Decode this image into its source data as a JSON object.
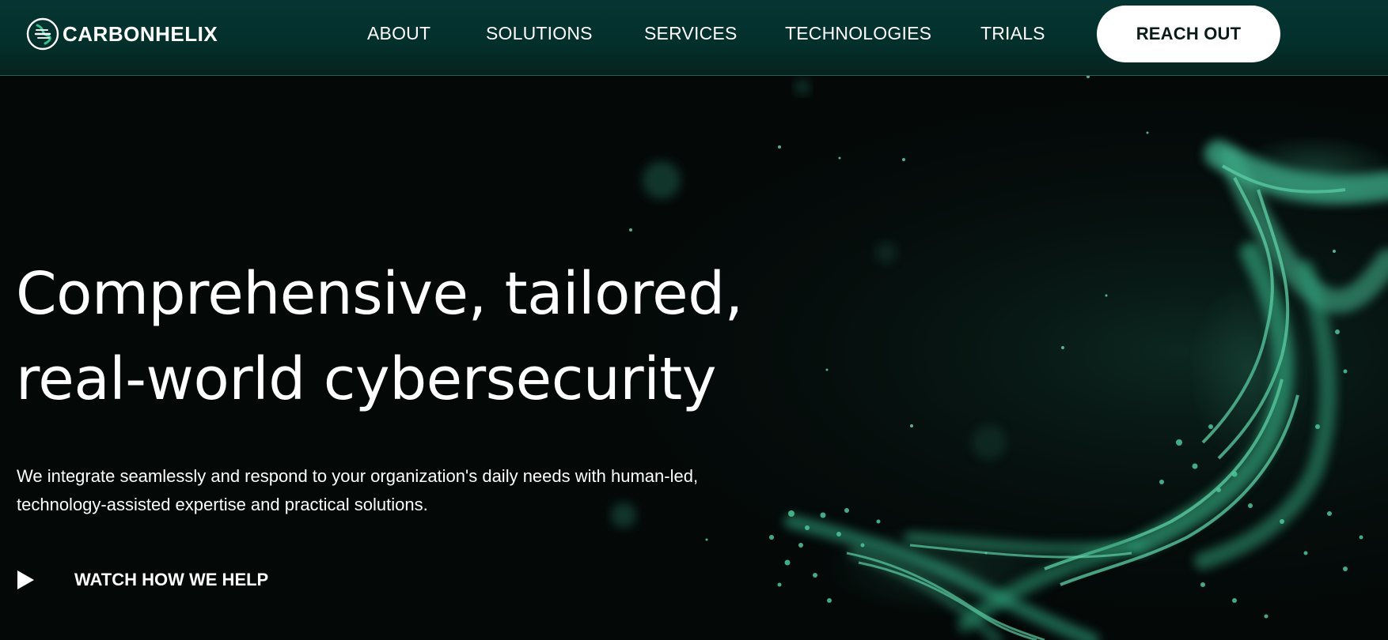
{
  "brand": {
    "name": "CARBONHELIX",
    "logo_icon": "helix-logo-icon",
    "accent": "#3dbf8f"
  },
  "nav": {
    "items": [
      {
        "label": "ABOUT"
      },
      {
        "label": "SOLUTIONS"
      },
      {
        "label": "SERVICES"
      },
      {
        "label": "TECHNOLOGIES"
      },
      {
        "label": "TRIALS"
      }
    ],
    "cta_label": "REACH OUT"
  },
  "hero": {
    "headline_line1": "Comprehensive, tailored,",
    "headline_line2": "real-world cybersecurity",
    "subtext_line1": "We integrate seamlessly and respond to your organization's daily needs with human-led,",
    "subtext_line2": "technology-assisted expertise and practical solutions.",
    "watch_label": "WATCH HOW WE HELP",
    "watch_icon": "play-icon"
  },
  "colors": {
    "header_bg": "#053532",
    "page_bg": "#040908",
    "particles": "#3fae89",
    "cta_bg": "#ffffff",
    "cta_text": "#0a1b19"
  }
}
